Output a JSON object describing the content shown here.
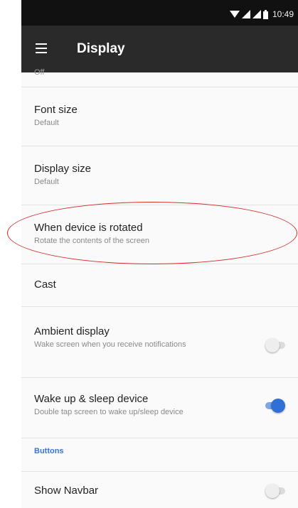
{
  "status_bar": {
    "time": "10:49",
    "icons": [
      "wifi-icon",
      "signal-icon",
      "signal-icon",
      "battery-icon"
    ]
  },
  "app_bar": {
    "title": "Display",
    "menu_icon": "hamburger-menu-icon"
  },
  "settings": {
    "partial_item_text": "Off",
    "font_size": {
      "title": "Font size",
      "summary": "Default"
    },
    "display_size": {
      "title": "Display size",
      "summary": "Default"
    },
    "rotation": {
      "title": "When device is rotated",
      "summary": "Rotate the contents of the screen"
    },
    "cast": {
      "title": "Cast"
    },
    "ambient_display": {
      "title": "Ambient display",
      "summary": "Wake screen when you receive notifications",
      "enabled": false
    },
    "wake_sleep": {
      "title": "Wake up & sleep device",
      "summary": "Double tap screen to wake up/sleep device",
      "enabled": true
    },
    "buttons_header": "Buttons",
    "show_navbar": {
      "title": "Show Navbar",
      "enabled": false
    }
  },
  "colors": {
    "accent": "#2f6fd6",
    "app_bar": "#2a2a2a",
    "status_bar": "#111111",
    "annotation": "#d0312d"
  }
}
